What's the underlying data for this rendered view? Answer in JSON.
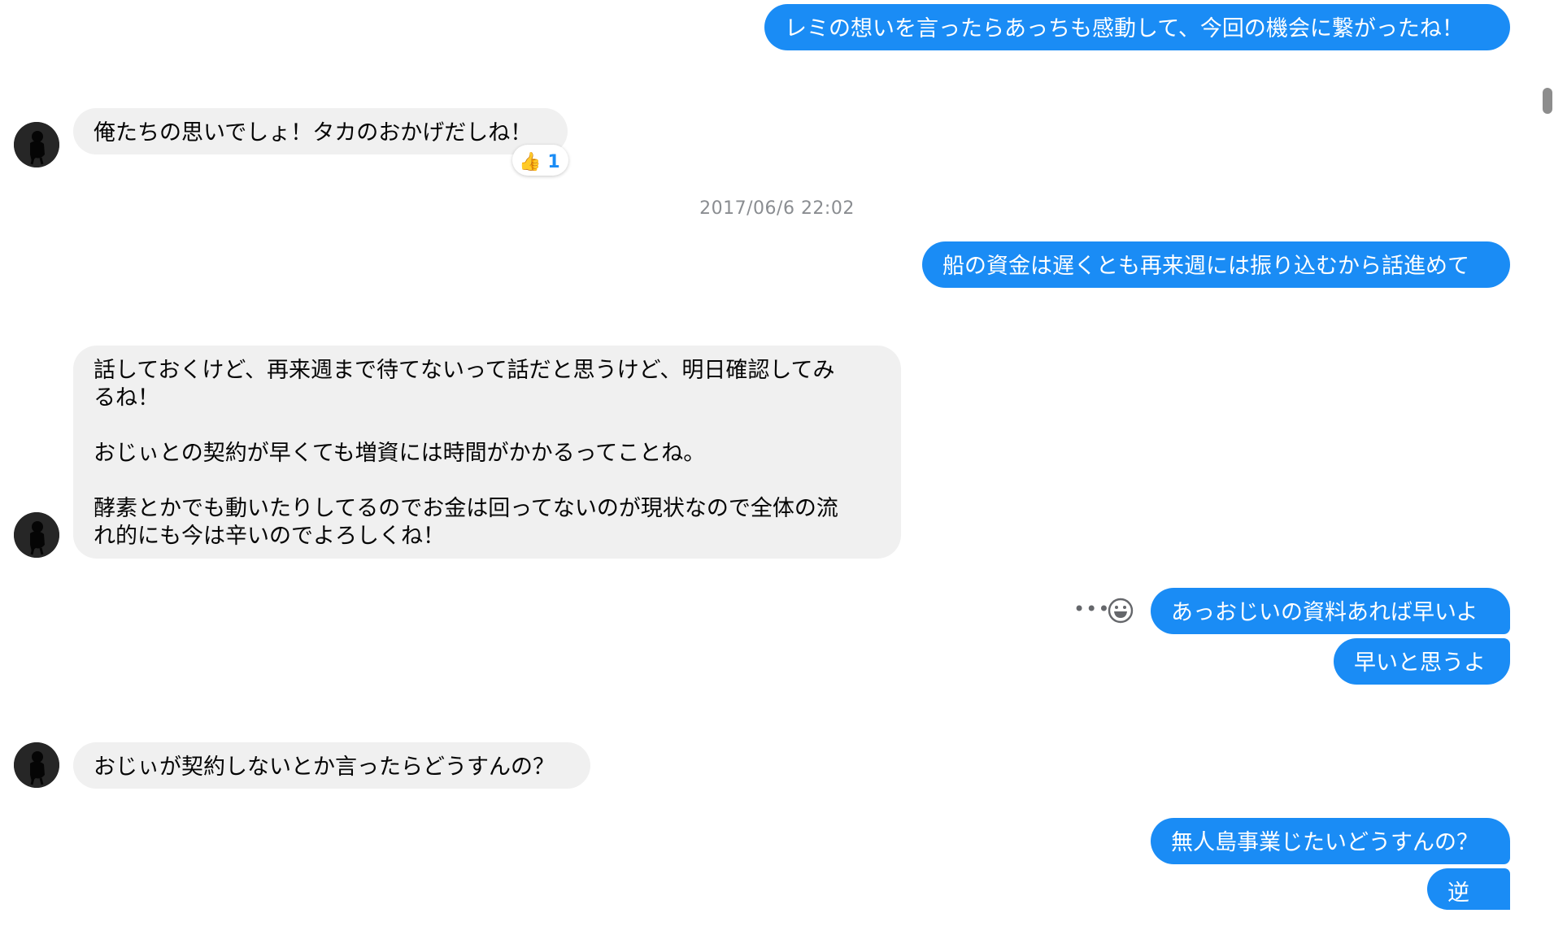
{
  "messages": [
    {
      "dir": "out",
      "text": "レミの想いを言ったらあっちも感動して、今回の機会に繋がったね！"
    },
    {
      "dir": "in",
      "text": "俺たちの思いでしょ！タカのおかげだしね！",
      "reaction": {
        "emoji": "👍",
        "count": "1"
      }
    },
    {
      "dir": "out",
      "text": "船の資金は遅くとも再来週には振り込むから話進めて"
    },
    {
      "dir": "in",
      "text": "話しておくけど、再来週まで待てないって話だと思うけど、明日確認してみ\nるね！\n\nおじぃとの契約が早くても増資には時間がかかるってことね。\n\n酵素とかでも動いたりしてるのでお金は回ってないのが現状なので全体の流\nれ的にも今は辛いのでよろしくね！"
    },
    {
      "dir": "out",
      "text": "あっおじいの資料あれば早いよ"
    },
    {
      "dir": "out",
      "text": "早いと思うよ"
    },
    {
      "dir": "in",
      "text": "おじぃが契約しないとか言ったらどうすんの？"
    },
    {
      "dir": "out",
      "text": "無人島事業じたいどうすんの？"
    },
    {
      "dir": "out",
      "text": "逆に"
    }
  ],
  "timestamp": "2017/06/6 22:02",
  "colors": {
    "outgoing": "#1a8cf5",
    "incoming": "#f0f0f0",
    "timestamp": "#8a8d91"
  },
  "icons": {
    "more": "more-options-icon",
    "emoji": "emoji-reaction-icon",
    "avatar": "contact-avatar"
  }
}
